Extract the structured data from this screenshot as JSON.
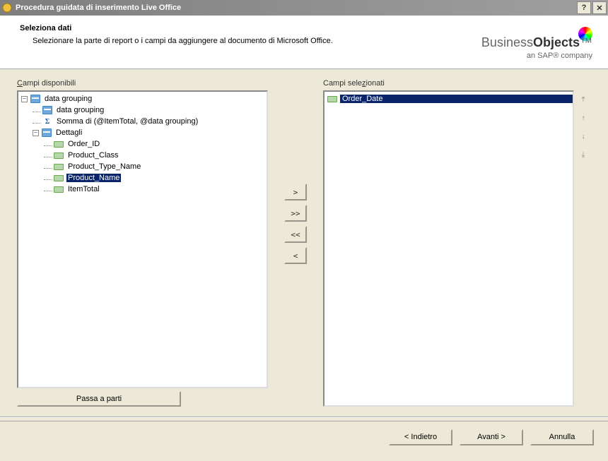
{
  "titlebar": {
    "title": "Procedura guidata di inserimento Live Office"
  },
  "header": {
    "heading": "Seleziona dati",
    "description": "Selezionare la parte di report o i campi da aggiungere al documento di Microsoft Office."
  },
  "brand": {
    "name1": "Business ",
    "name2": "Objects",
    "tagline": "an SAP® company"
  },
  "labels": {
    "available": "Campi disponibili",
    "selected": "Campi selezionati",
    "parts_btn": "Passa a parti"
  },
  "tree": [
    {
      "level": 0,
      "expander": "-",
      "icon": "group",
      "label": "data grouping",
      "selected": false
    },
    {
      "level": 1,
      "expander": "",
      "icon": "group",
      "label": "data grouping",
      "selected": false
    },
    {
      "level": 1,
      "expander": "",
      "icon": "sigma",
      "label": "Somma di (@ItemTotal, @data grouping)",
      "selected": false
    },
    {
      "level": 1,
      "expander": "-",
      "icon": "group",
      "label": "Dettagli",
      "selected": false
    },
    {
      "level": 2,
      "expander": "",
      "icon": "field",
      "label": "Order_ID",
      "selected": false
    },
    {
      "level": 2,
      "expander": "",
      "icon": "field",
      "label": "Product_Class",
      "selected": false
    },
    {
      "level": 2,
      "expander": "",
      "icon": "field",
      "label": "Product_Type_Name",
      "selected": false
    },
    {
      "level": 2,
      "expander": "",
      "icon": "field",
      "label": "Product_Name",
      "selected": true
    },
    {
      "level": 2,
      "expander": "",
      "icon": "field",
      "label": "ItemTotal",
      "selected": false
    }
  ],
  "selected_fields": [
    {
      "icon": "field",
      "label": "Order_Date",
      "selected": true
    }
  ],
  "move_buttons": {
    "add": ">",
    "add_all": ">>",
    "remove_all": "<<",
    "remove": "<"
  },
  "order_buttons": {
    "top": "⤒",
    "up": "↑",
    "down": "↓",
    "bottom": "⤓"
  },
  "footer": {
    "back": "< Indietro",
    "next": "Avanti >",
    "cancel": "Annulla"
  }
}
